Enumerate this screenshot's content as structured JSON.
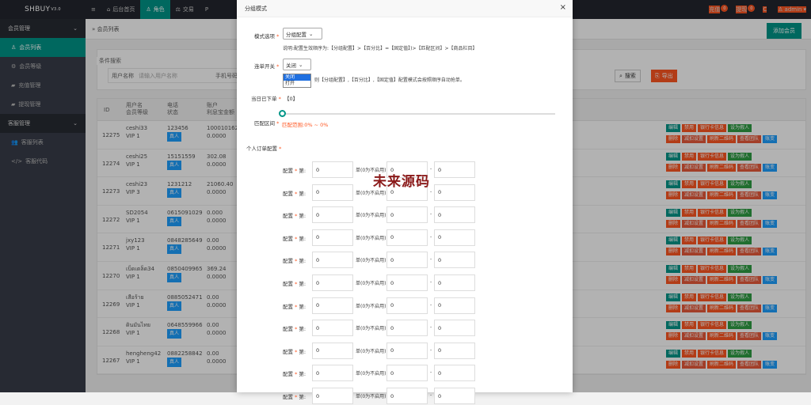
{
  "topbar": {
    "logo": "SHBUY",
    "version": "V3.0",
    "menu_icon": "≡",
    "nav": [
      {
        "icon": "⌂",
        "label": "后台首页"
      },
      {
        "icon": "♙",
        "label": "角色"
      },
      {
        "icon": "⚖",
        "label": "交易"
      },
      {
        "icon": "P",
        "label": ""
      }
    ],
    "recharge": "充值",
    "recharge_badge": "0",
    "withdraw": "提现",
    "withdraw_badge": "0",
    "refresh": "C",
    "user": "admin"
  },
  "sidebar": {
    "groups": [
      {
        "label": "会员管理",
        "items": [
          {
            "icon": "♙",
            "label": "会员列表",
            "active": true
          },
          {
            "icon": "⚙",
            "label": "会员等级"
          },
          {
            "icon": "▰",
            "label": "充值管理"
          },
          {
            "icon": "▰",
            "label": "提现管理"
          }
        ]
      },
      {
        "label": "客服管理",
        "items": [
          {
            "icon": "👥",
            "label": "客服列表"
          },
          {
            "icon": "</>",
            "label": "客服代码"
          }
        ]
      }
    ]
  },
  "breadcrumb": "会员列表",
  "add_member": "添加会员",
  "search": {
    "legend": "条件搜索",
    "username_label": "用户名称",
    "username_placeholder": "请输入用户名称",
    "phone_label": "手机号码",
    "search_btn": "搜索",
    "export_btn": "导出"
  },
  "table": {
    "headers": {
      "id": "ID",
      "user": "用户名",
      "level": "会员等级",
      "phone": "电话",
      "status": "状态",
      "acct": "账户",
      "balance": "利息宝金额"
    },
    "rows": [
      {
        "id": "12275",
        "user": "ceshi33",
        "vip": "VIP 1",
        "phone": "123456",
        "status": "真人",
        "bal1": "100010162.7",
        "bal2": "0.0000"
      },
      {
        "id": "12274",
        "user": "ceshi25",
        "vip": "VIP 1",
        "phone": "15151559",
        "status": "真人",
        "bal1": "302.08",
        "bal2": "0.0000"
      },
      {
        "id": "12273",
        "user": "ceshi23",
        "vip": "VIP 3",
        "phone": "1231212",
        "status": "真人",
        "bal1": "21060.40",
        "bal2": "0.0000"
      },
      {
        "id": "12272",
        "user": "SD2054",
        "vip": "VIP 1",
        "phone": "0615091029",
        "status": "真人",
        "bal1": "0.000",
        "bal2": "0.0000"
      },
      {
        "id": "12271",
        "user": "jxy123",
        "vip": "VIP 1",
        "phone": "0848285649",
        "status": "真人",
        "bal1": "0.00",
        "bal2": "0.0000"
      },
      {
        "id": "12270",
        "user": "เบ็ดเตล็ด34",
        "vip": "VIP 1",
        "phone": "0850409965",
        "status": "真人",
        "bal1": "369.24",
        "bal2": "0.0000"
      },
      {
        "id": "12269",
        "user": "เสือร้าย",
        "vip": "VIP 1",
        "phone": "0885052471",
        "status": "真人",
        "bal1": "0.00",
        "bal2": "0.0000"
      },
      {
        "id": "12268",
        "user": "ดินมันไทย",
        "vip": "VIP 1",
        "phone": "0648559966",
        "status": "真人",
        "bal1": "0.00",
        "bal2": "0.0000"
      },
      {
        "id": "12267",
        "user": "hengheng42",
        "vip": "VIP 1",
        "phone": "0882258842",
        "status": "真人",
        "bal1": "0.00",
        "bal2": "0.0000"
      }
    ],
    "actions_row1": [
      "编辑",
      "禁用",
      "银行卡信息",
      "设为假人"
    ],
    "actions_row2": [
      "删除",
      "减扣设置",
      "刷新二维码",
      "查看团队",
      "账变"
    ]
  },
  "modal": {
    "title": "分组模式",
    "close": "×",
    "mode_label": "模式选项",
    "mode_value": "分组配置",
    "mode_note": "说明:配置生效顺序为:【分组配置】>【百分比】=【固定值】)>【匹配区间】>【商品栏目】",
    "connect_label": "连单开关",
    "connect_value": "关闭",
    "dropdown": [
      "关闭",
      "打开"
    ],
    "connect_note": "则【分组配置】,【百分比】,【固定值】配置模式会按照顺序自动抢单。",
    "today_label": "当日已下单",
    "today_value": "【0】",
    "range_label": "匹配区间",
    "range_text": "匹配范围:0% ~ 0%",
    "personal_label": "个人订单配置",
    "group_label": "配置",
    "group_unit": "单(0为不启用)",
    "group_sep": "-",
    "groups": [
      {
        "idx": "第",
        "a": "0",
        "b": "0",
        "c": "0"
      },
      {
        "idx": "第",
        "a": "0",
        "b": "0",
        "c": "0"
      },
      {
        "idx": "第",
        "a": "0",
        "b": "0",
        "c": "0"
      },
      {
        "idx": "第",
        "a": "0",
        "b": "0",
        "c": "0"
      },
      {
        "idx": "第",
        "a": "0",
        "b": "0",
        "c": "0"
      },
      {
        "idx": "第",
        "a": "0",
        "b": "0",
        "c": "0"
      },
      {
        "idx": "第",
        "a": "0",
        "b": "0",
        "c": "0"
      },
      {
        "idx": "第",
        "a": "0",
        "b": "0",
        "c": "0"
      },
      {
        "idx": "第",
        "a": "0",
        "b": "0",
        "c": "0"
      },
      {
        "idx": "第",
        "a": "0",
        "b": "0",
        "c": "0"
      },
      {
        "idx": "第",
        "a": "0",
        "b": "0",
        "c": "0"
      }
    ],
    "watermark": "未来源码"
  }
}
